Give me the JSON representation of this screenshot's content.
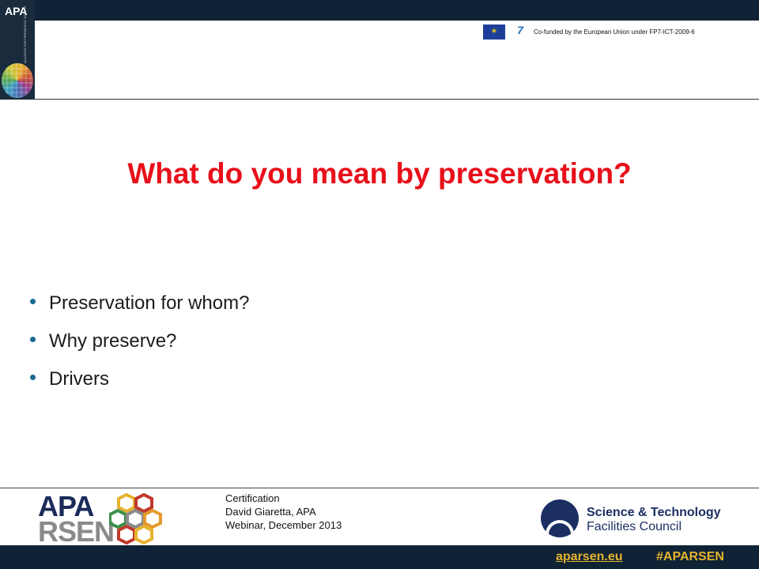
{
  "header": {
    "logo_text": "APA",
    "logo_subtitle": "ALLIANCE FOR PERMANENT ACCESS",
    "funding_text": "Co-funded by the European Union under FP7-ICT-2009-6",
    "fp7_logo_text": "7"
  },
  "slide": {
    "title": "What do you mean by preservation?",
    "bullets": [
      "Preservation  for whom?",
      "Why preserve?",
      "Drivers"
    ]
  },
  "footer": {
    "logo_apa": "APA",
    "logo_rsen": "RSEN",
    "info_line1": "Certification",
    "info_line2": "David Giaretta, APA",
    "info_line3": "Webinar, December 2013",
    "partner_name_line1": "Science & Technology",
    "partner_name_line2": "Facilities Council",
    "link": "aparsen.eu",
    "hashtag": "#APARSEN"
  },
  "colors": {
    "title": "#e8101a",
    "bar": "#0f2236",
    "accent": "#e5b32d",
    "bullet": "#1a6a8f"
  },
  "icons": [
    "eu-flag-icon",
    "fp7-logo-icon",
    "apa-globe-icon",
    "aparsen-hexagon-icon",
    "stfc-logo-icon"
  ]
}
